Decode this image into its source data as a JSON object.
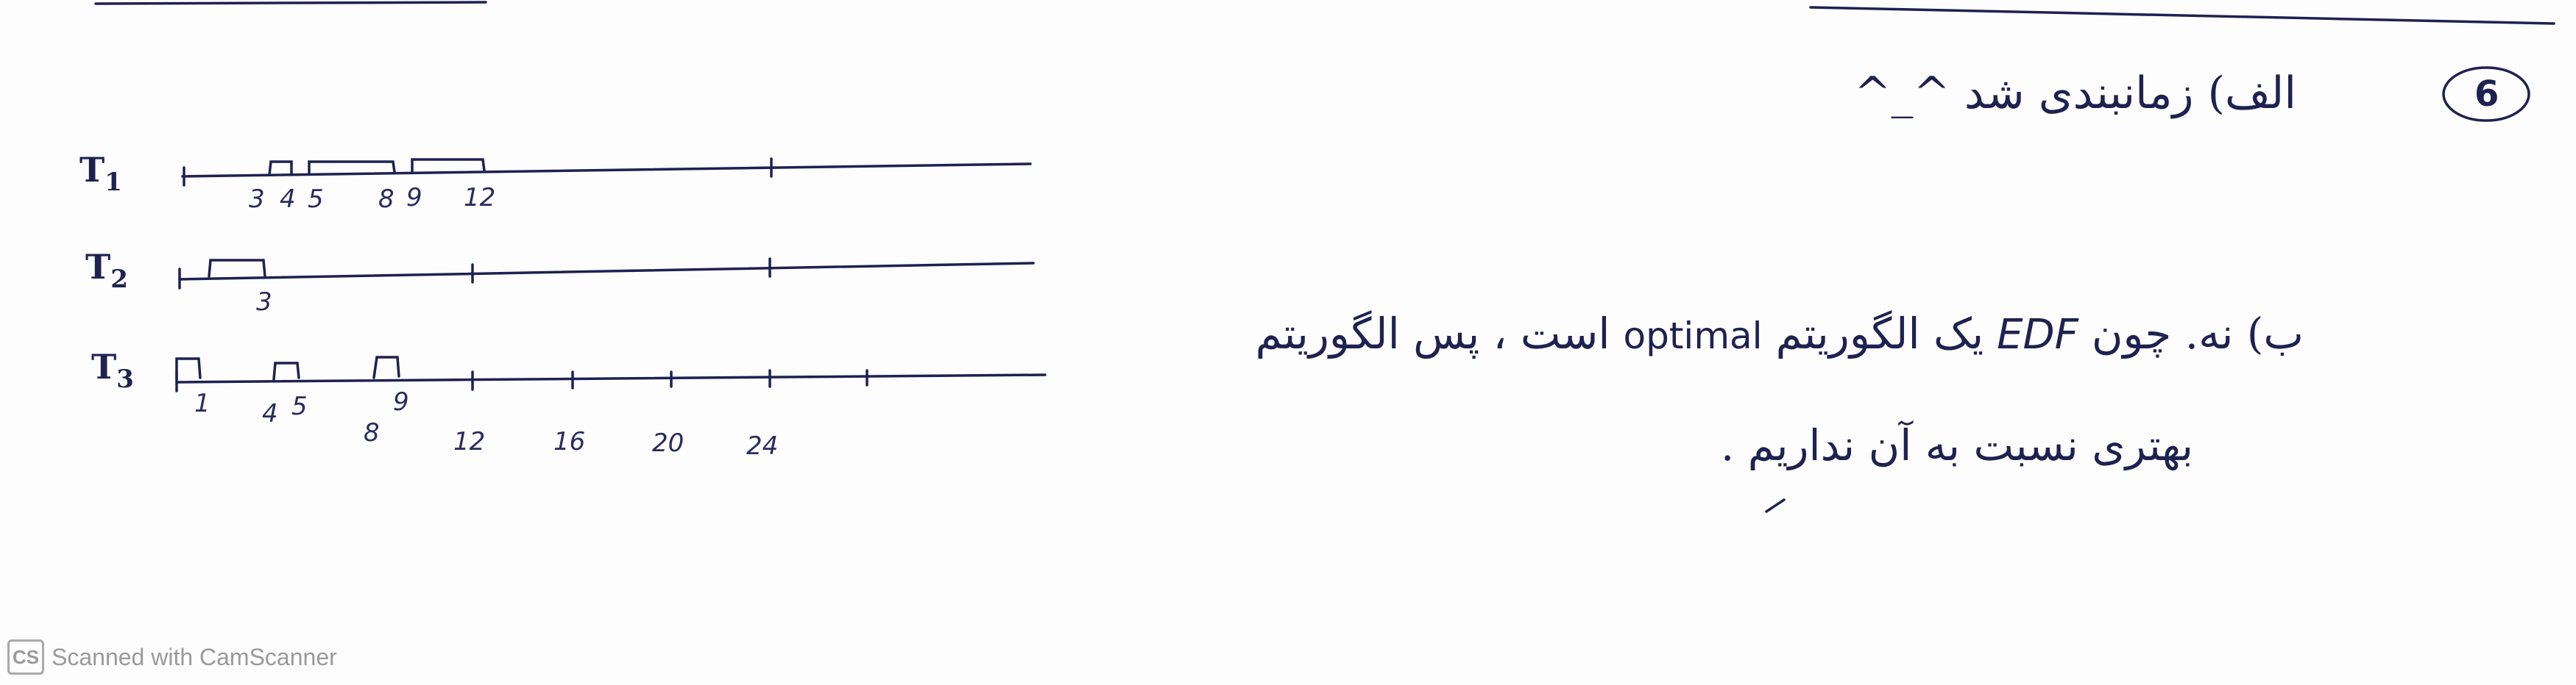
{
  "question_number": "6",
  "part_a": {
    "text": "الف) زمانبندی شد ^_^"
  },
  "part_b": {
    "line1_prefix": "ب) نه. چون",
    "line1_edf": "EDF",
    "line1_mid": "یک الگوریتم",
    "line1_optimal": "optimal",
    "line1_suffix": "است ، پس الگوریتم",
    "line2": "بهتری نسبت به آن نداریم ."
  },
  "timeline": {
    "tasks": [
      {
        "name": "T",
        "sub": "1",
        "ticks": [
          "3",
          "4",
          "5",
          "8",
          "9",
          "12"
        ]
      },
      {
        "name": "T",
        "sub": "2",
        "ticks": [
          "3"
        ]
      },
      {
        "name": "T",
        "sub": "3",
        "ticks": [
          "1",
          "4",
          "5",
          "8",
          "9",
          "12",
          "16",
          "20",
          "24"
        ]
      }
    ]
  },
  "watermark": {
    "logo": "CS",
    "text": "Scanned with CamScanner"
  },
  "colors": {
    "ink": "#1f2150",
    "watermark": "#9a9a9a"
  }
}
